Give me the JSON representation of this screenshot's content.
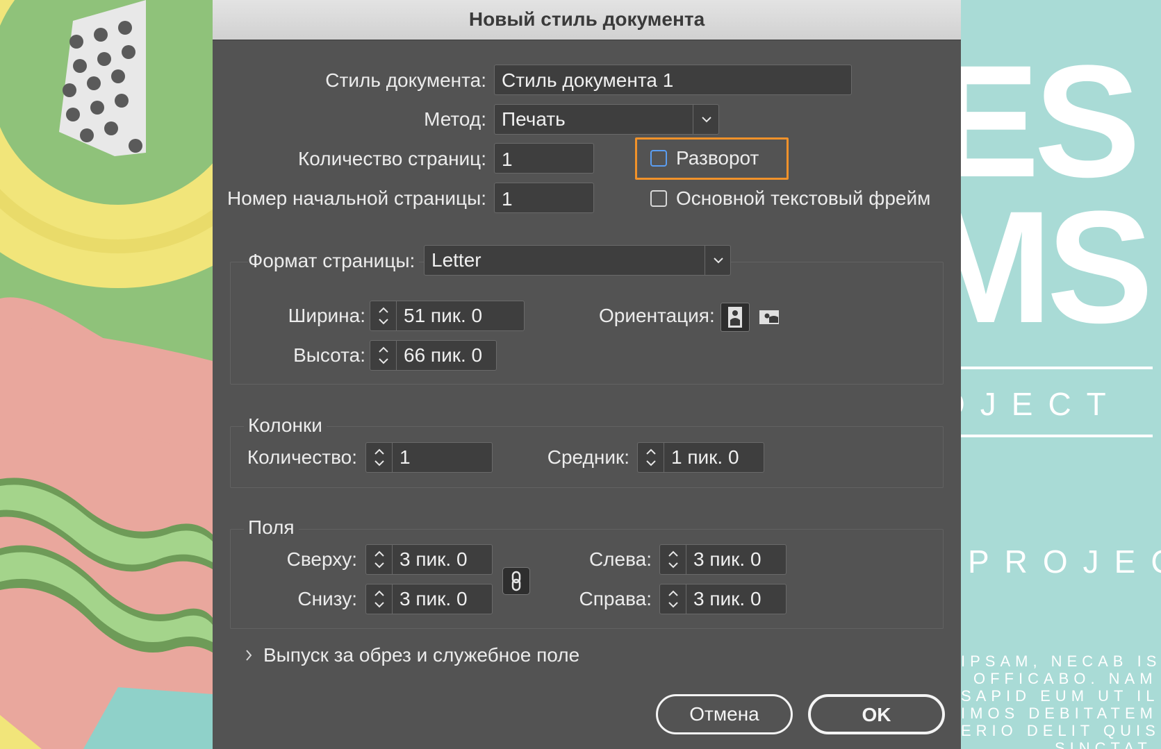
{
  "dialog": {
    "title": "Новый стиль документа",
    "document_style_label": "Стиль документа:",
    "document_style_value": "Стиль документа 1",
    "method_label": "Метод:",
    "method_value": "Печать",
    "page_count_label": "Количество страниц:",
    "page_count_value": "1",
    "start_page_label": "Номер начальной страницы:",
    "start_page_value": "1",
    "facing_pages_label": "Разворот",
    "facing_pages_checked": false,
    "primary_text_frame_label": "Основной текстовый фрейм",
    "primary_text_frame_checked": false
  },
  "page_size": {
    "label": "Формат страницы:",
    "value": "Letter",
    "width_label": "Ширина:",
    "width_value": "51 пик. 0",
    "height_label": "Высота:",
    "height_value": "66 пик. 0",
    "orientation_label": "Ориентация:",
    "orientation_selected": "portrait"
  },
  "columns": {
    "title": "Колонки",
    "count_label": "Количество:",
    "count_value": "1",
    "gutter_label": "Средник:",
    "gutter_value": "1 пик. 0"
  },
  "margins": {
    "title": "Поля",
    "top_label": "Сверху:",
    "top_value": "3 пик. 0",
    "bottom_label": "Снизу:",
    "bottom_value": "3 пик. 0",
    "left_label": "Слева:",
    "left_value": "3 пик. 0",
    "right_label": "Справа:",
    "right_value": "3 пик. 0"
  },
  "bleed": {
    "label": "Выпуск за обрез и служебное поле",
    "expanded": false
  },
  "buttons": {
    "cancel": "Отмена",
    "ok": "OK"
  },
  "background_poster": {
    "big_line_1": "ES",
    "big_line_2": "MS",
    "subtitle_1": "OJECT",
    "subtitle_2": "PROJECT",
    "body_lines": [
      "IPSAM, NECAB IS",
      "OFFICABO. NAM",
      "SAPID EUM UT IL",
      "IMOS DEBITATEM",
      "ERIO DELIT QUIS",
      "SINCTAT"
    ]
  },
  "colors": {
    "dialog_bg": "#535353",
    "highlight": "#f1922a",
    "focus": "#5b9ef2",
    "poster_bg": "#a9dbd6"
  }
}
